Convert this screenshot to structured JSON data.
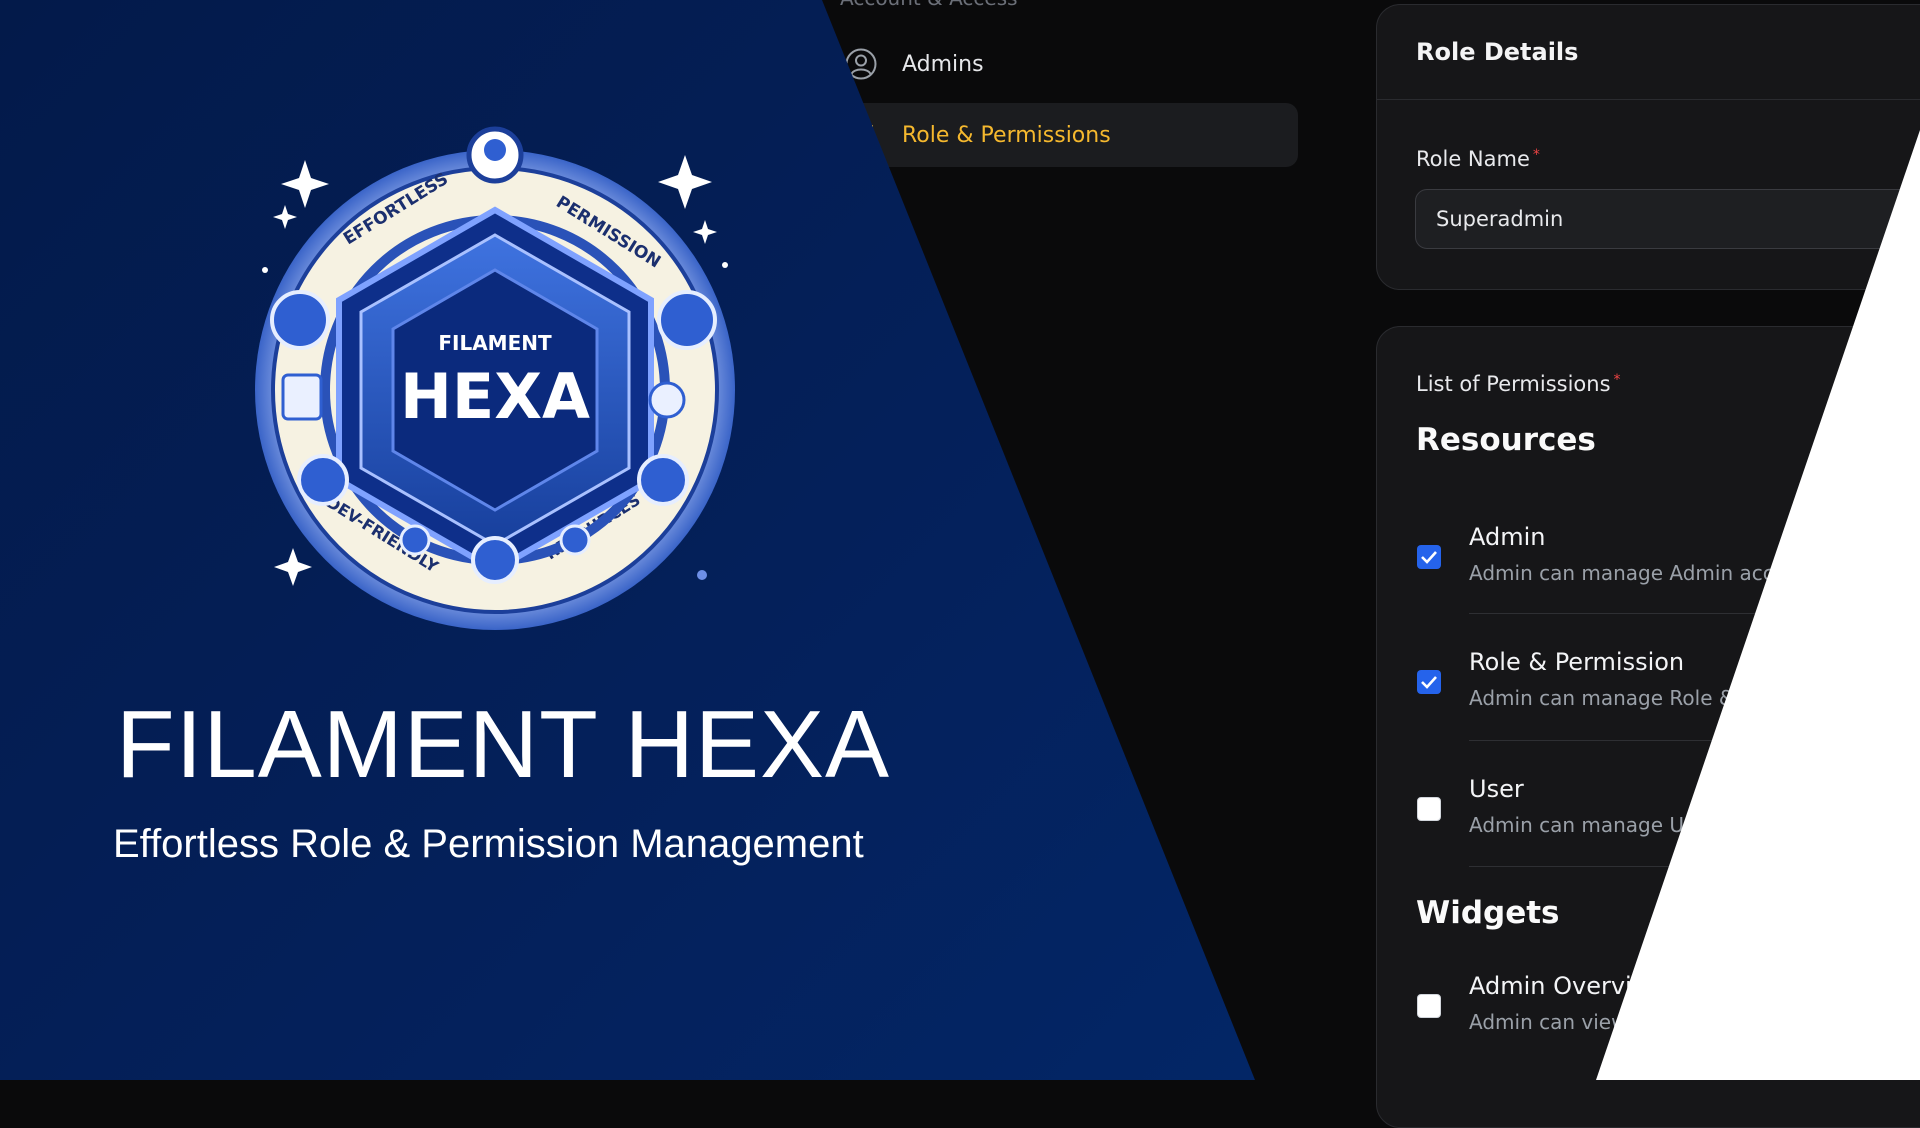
{
  "navigation": {
    "group_label": "Account & Access",
    "items": [
      {
        "label": "Admins",
        "icon": "user-circle-icon",
        "active": false
      },
      {
        "label": "Role & Permissions",
        "icon": "shield-icon",
        "active": true
      }
    ]
  },
  "role_details": {
    "title": "Role Details",
    "role_name_label": "Role Name",
    "role_name_value": "Superadmin",
    "required_mark": "*"
  },
  "permissions": {
    "label": "List of Permissions",
    "required_mark": "*",
    "sections": [
      {
        "title": "Resources",
        "items": [
          {
            "name": "Admin",
            "description": "Admin can manage Admin account",
            "checked": true
          },
          {
            "name": "Role & Permission",
            "description": "Admin can manage Role & Permission",
            "checked": true
          },
          {
            "name": "User",
            "description": "Admin can manage User accounts",
            "checked": false
          }
        ]
      },
      {
        "title": "Widgets",
        "items": [
          {
            "name": "Admin Overview",
            "description": "Admin can view admin overview",
            "checked": false
          }
        ]
      }
    ]
  },
  "banner": {
    "title": "FILAMENT HEXA",
    "subtitle": "Effortless Role & Permission Management",
    "emblem": {
      "top_text": "FILAMENT",
      "main_text": "HEXA",
      "ring_words": [
        "EFFORTLESS",
        "PERMISSION",
        "DEV-FRIENDLY",
        "RESOURCES"
      ]
    }
  },
  "colors": {
    "accent_active_nav": "#f5b82e",
    "checkbox_checked": "#2563eb",
    "banner_blue": "#04205a",
    "required": "#ef4444"
  }
}
